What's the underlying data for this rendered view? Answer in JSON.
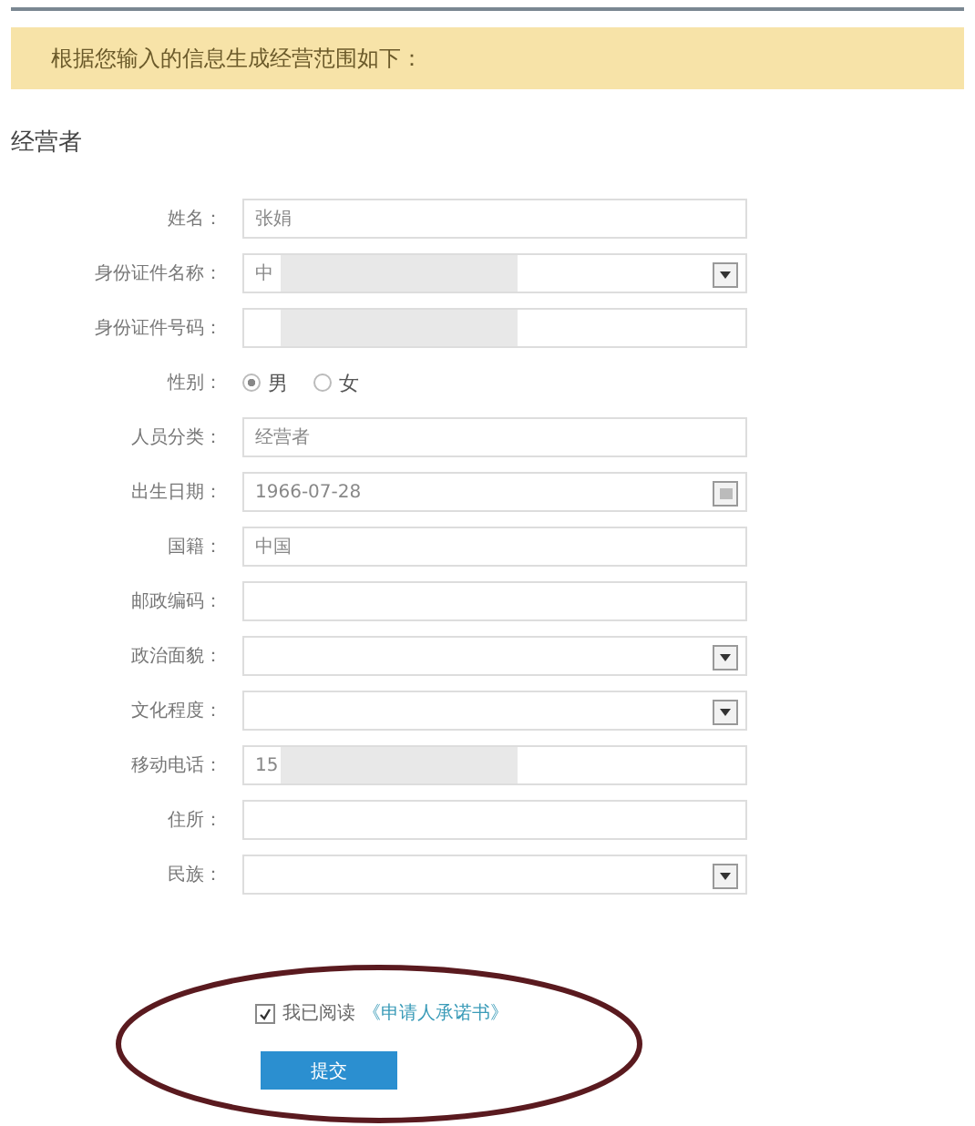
{
  "notice": "根据您输入的信息生成经营范围如下：",
  "section_title": "经营者",
  "fields": [
    {
      "kind": "text",
      "label": "姓名：",
      "value": "张娟"
    },
    {
      "kind": "select",
      "label": "身份证件名称：",
      "value": "中",
      "redacted": true
    },
    {
      "kind": "text",
      "label": "身份证件号码：",
      "redacted": true
    },
    {
      "kind": "radio",
      "label": "性别：",
      "options": [
        {
          "label": "男",
          "selected": true
        },
        {
          "label": "女",
          "selected": false
        }
      ]
    },
    {
      "kind": "text",
      "label": "人员分类：",
      "value": "经营者"
    },
    {
      "kind": "date",
      "label": "出生日期：",
      "value": "1966-07-28"
    },
    {
      "kind": "text",
      "label": "国籍：",
      "value": "中国"
    },
    {
      "kind": "text",
      "label": "邮政编码："
    },
    {
      "kind": "select",
      "label": "政治面貌："
    },
    {
      "kind": "select",
      "label": "文化程度："
    },
    {
      "kind": "text",
      "label": "移动电话：",
      "value": "15",
      "redacted": true
    },
    {
      "kind": "text",
      "label": "住所："
    },
    {
      "kind": "select",
      "label": "民族："
    }
  ],
  "agreement": {
    "checked": true,
    "text": "我已阅读",
    "link": "《申请人承诺书》"
  },
  "submit": "提交",
  "annotation": {
    "circled": true
  }
}
